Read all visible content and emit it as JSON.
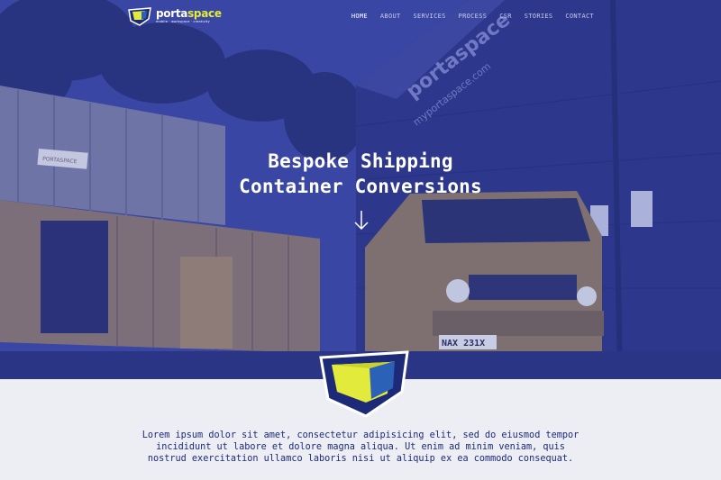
{
  "brand": {
    "name_part1": "porta",
    "name_part2": "space",
    "tagline": "mobile · workspace · creativity"
  },
  "nav": {
    "items": [
      {
        "label": "HOME",
        "active": true
      },
      {
        "label": "ABOUT",
        "active": false
      },
      {
        "label": "SERVICES",
        "active": false
      },
      {
        "label": "PROCESS",
        "active": false
      },
      {
        "label": "CSR",
        "active": false
      },
      {
        "label": "STORIES",
        "active": false
      },
      {
        "label": "CONTACT",
        "active": false
      }
    ]
  },
  "hero": {
    "title_line1": "Bespoke Shipping",
    "title_line2": "Container Conversions",
    "overlay_color": "#323f9a",
    "building_sign_brand": "portaspace",
    "building_sign_url": "myportaspace.com",
    "container_sign": "PORTASPACE",
    "van_plate": "NAX 231X"
  },
  "intro": {
    "text": "Lorem ipsum dolor sit amet, consectetur adipisicing elit, sed do eiusmod tempor incididunt ut labore et dolore magna aliqua. Ut enim ad minim veniam, quis nostrud exercitation ullamco laboris nisi ut aliquip ex ea commodo consequat."
  },
  "colors": {
    "accent_yellow": "#e2ea3b",
    "brand_blue": "#1d2a78",
    "section_bg": "#eceef3"
  }
}
